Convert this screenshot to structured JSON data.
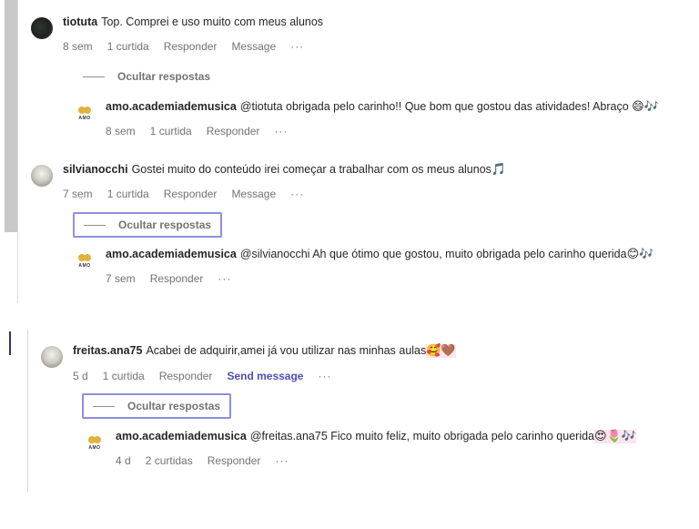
{
  "comments": [
    {
      "username": "tiotuta",
      "text": "Top. Comprei e uso muito com meus alunos",
      "time": "8 sem",
      "likes": "1 curtida",
      "reply": "Responder",
      "message": "Message",
      "more": "···",
      "toggle_label": "Ocultar respostas",
      "replies": [
        {
          "username": "amo.academiademusica",
          "text": "@tiotuta obrigada pelo carinho!! Que bom que gostou das atividades! Abraço",
          "emoji": "😄🎶",
          "time": "8 sem",
          "likes": "1 curtida",
          "reply": "Responder",
          "more": "···"
        }
      ]
    },
    {
      "username": "silvianocchi",
      "text": "Gostei muito do conteúdo irei começar a trabalhar com os meus alunos",
      "emoji": "🎵",
      "time": "7 sem",
      "likes": "1 curtida",
      "reply": "Responder",
      "message": "Message",
      "more": "···",
      "toggle_label": "Ocultar respostas",
      "replies": [
        {
          "username": "amo.academiademusica",
          "text": "@silvianocchi Ah que ótimo que gostou, muito obrigada pelo carinho querida",
          "emoji": "😊🎶",
          "time": "7 sem",
          "reply": "Responder",
          "more": "···"
        }
      ]
    },
    {
      "username": "freitas.ana75",
      "text": "Acabei de adquirir,amei já vou utilizar nas minhas aulas",
      "emoji": "🥰🤎",
      "time": "5 d",
      "likes": "1 curtida",
      "reply": "Responder",
      "message": "Send message",
      "more": "···",
      "toggle_label": "Ocultar respostas",
      "replies": [
        {
          "username": "amo.academiademusica",
          "text": "@freitas.ana75 Fico muito feliz, muito obrigada pelo carinho querida",
          "emoji": "😍🌷🎶",
          "time": "4 d",
          "likes": "2 curtidas",
          "reply": "Responder",
          "more": "···"
        }
      ]
    }
  ],
  "avatar_logo_text": "AMO",
  "colors": {
    "send_message": "#4a4fb8",
    "focus_ring": "#8b8fe0",
    "meta_text": "#737373",
    "scrollbar": "#c8c8c8"
  }
}
